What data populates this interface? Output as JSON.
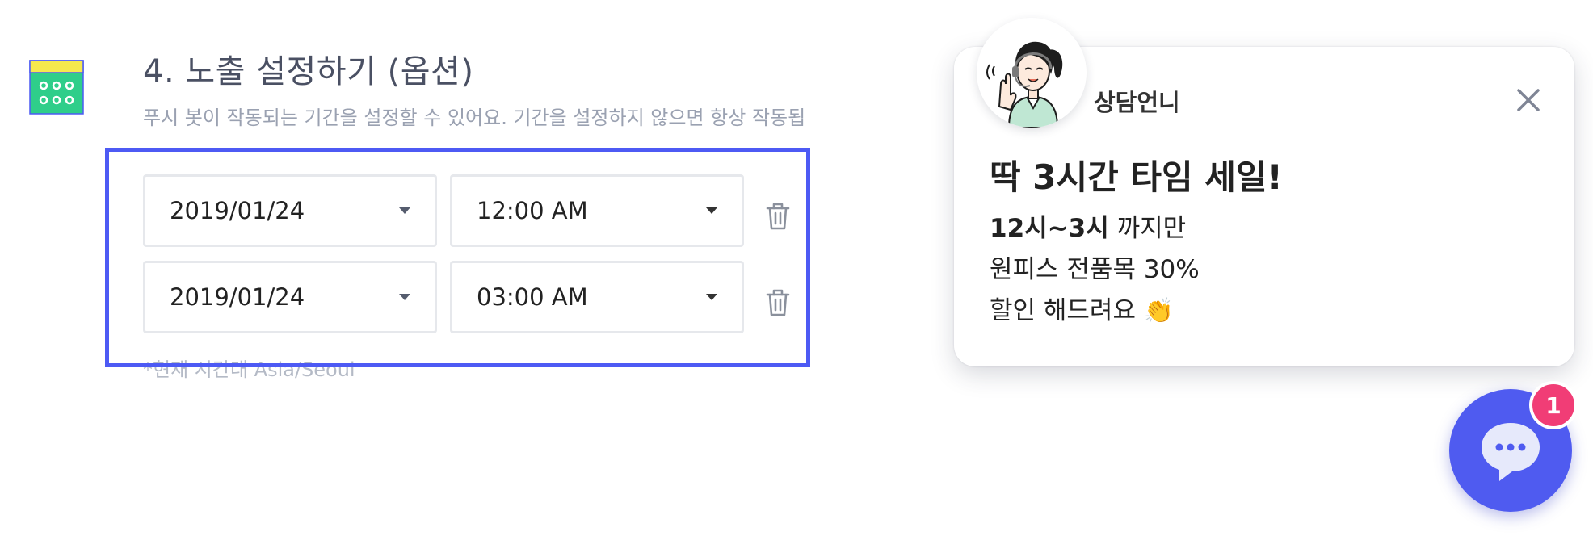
{
  "section": {
    "title": "4. 노출 설정하기 (옵션)",
    "description": "푸시 봇이 작동되는 기간을 설정할 수 있어요. 기간을 설정하지 않으면 항상 작동됩",
    "icon": "calendar-icon",
    "accent_color": "#4d5af4"
  },
  "schedule": {
    "rows": [
      {
        "date": "2019/01/24",
        "time": "12:00 AM"
      },
      {
        "date": "2019/01/24",
        "time": "03:00 AM"
      }
    ],
    "timezone_note": "*현재 시간대 Asia/Seoul"
  },
  "popup": {
    "agent_name": "상담언니",
    "title": "딱 3시간 타임 세일!",
    "body_bold": "12시~3시",
    "body_line1_rest": " 까지만",
    "body_line2": "원피스 전품목 30%",
    "body_line3": "할인 해드려요",
    "clap_emoji": "👏"
  },
  "launcher": {
    "badge_count": "1",
    "color": "#4f5bf0",
    "badge_color": "#f13d76"
  }
}
